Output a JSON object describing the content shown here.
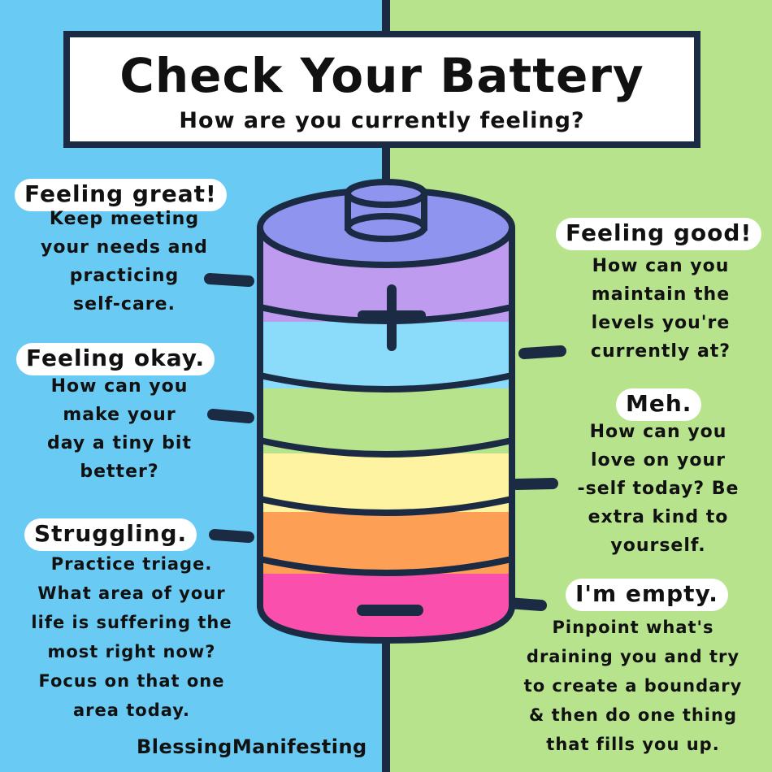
{
  "title": "Check Your Battery",
  "subtitle": "How are you currently feeling?",
  "colors": {
    "left_bg": "#69cbf4",
    "right_bg": "#b6e38b",
    "outline": "#1c2b44",
    "battery_top": "#8f95ef",
    "level_purple": "#bf9bf0",
    "level_blue": "#8bdcfa",
    "level_green": "#b6e38b",
    "level_yellow": "#fef3a0",
    "level_orange": "#fd9f55",
    "level_pink": "#fb4fae"
  },
  "icons": {
    "plus": "plus-sign-icon",
    "minus": "minus-sign-icon"
  },
  "levels": [
    {
      "heading": "Feeling great!",
      "lines": [
        "Keep meeting",
        "your needs and",
        "practicing",
        "self-care."
      ]
    },
    {
      "heading": "Feeling good!",
      "lines": [
        "How can you",
        "maintain the",
        "levels you're",
        "currently at?"
      ]
    },
    {
      "heading": "Feeling okay.",
      "lines": [
        "How can you",
        "make your",
        "day a tiny bit",
        "better?"
      ]
    },
    {
      "heading": "Meh.",
      "lines": [
        "How can you",
        "love on your",
        "-self today? Be",
        "extra kind to",
        "yourself."
      ]
    },
    {
      "heading": "Struggling.",
      "lines": [
        "Practice triage.",
        "What area of your",
        "life is suffering the",
        "most right now?",
        "Focus on that one",
        "area today."
      ]
    },
    {
      "heading": "I'm empty.",
      "lines": [
        "Pinpoint what's",
        "draining you and try",
        "to create a boundary",
        "& then do one thing",
        "that fills you up."
      ]
    }
  ],
  "credit": "BlessingManifesting"
}
